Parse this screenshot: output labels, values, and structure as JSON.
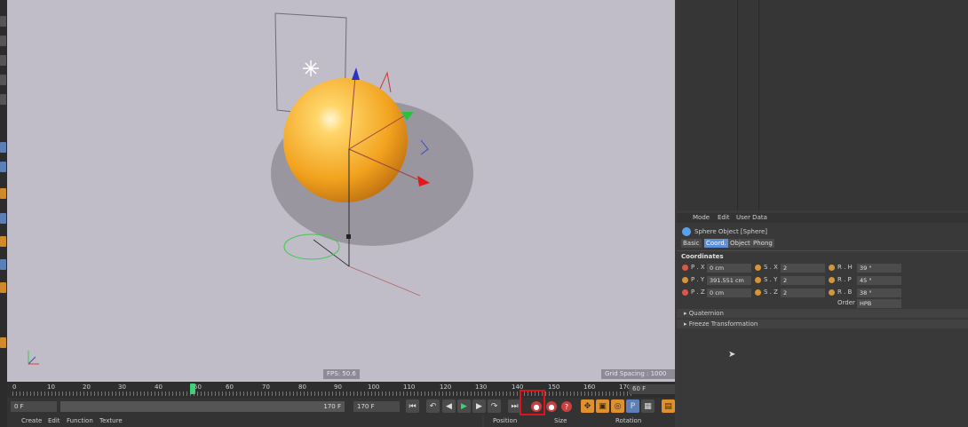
{
  "viewport": {
    "fps_readout": "FPS: 50.6",
    "grid_spacing": "Grid Spacing : 1000 cm"
  },
  "timeline": {
    "ticks": [
      "0",
      "10",
      "20",
      "30",
      "40",
      "50",
      "60",
      "70",
      "80",
      "90",
      "100",
      "110",
      "120",
      "130",
      "140",
      "150",
      "160",
      "170"
    ],
    "current_frame": "60 F"
  },
  "transport": {
    "start_field": "0 F",
    "range_end_inner": "170 F",
    "end_field": "170 F"
  },
  "bottom_bar": {
    "menu": [
      "Create",
      "Edit",
      "Function",
      "Texture"
    ],
    "coord_headers": [
      "Position",
      "Size",
      "Rotation"
    ]
  },
  "attributes": {
    "menu": [
      "Mode",
      "Edit",
      "User Data"
    ],
    "object_title": "Sphere Object [Sphere]",
    "tabs": [
      "Basic",
      "Coord.",
      "Object",
      "Phong"
    ],
    "active_tab": "Coord.",
    "section": "Coordinates",
    "rows": [
      {
        "p_label": "P . X",
        "p_val": "0 cm",
        "s_label": "S . X",
        "s_val": "2",
        "r_label": "R . H",
        "r_val": "39 °"
      },
      {
        "p_label": "P . Y",
        "p_val": "391.551 cm",
        "s_label": "S . Y",
        "s_val": "2",
        "r_label": "R . P",
        "r_val": "45 °"
      },
      {
        "p_label": "P . Z",
        "p_val": "0 cm",
        "s_label": "S . Z",
        "s_val": "2",
        "r_label": "R . B",
        "r_val": "38 °"
      }
    ],
    "order_label": "Order",
    "order_value": "HPB",
    "collapsed": [
      "Quaternion",
      "Freeze Transformation"
    ]
  },
  "colors": {
    "highlight": "#e0111b",
    "viewport_bg": "#c0bdc9",
    "active_tab": "#5d8fd6"
  }
}
